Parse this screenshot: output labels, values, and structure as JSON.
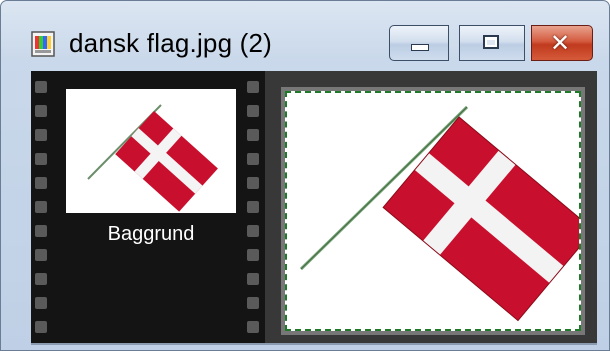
{
  "window": {
    "title": "dansk flag.jpg (2)",
    "buttons": {
      "minimize": "minimize",
      "maximize": "maximize",
      "close": "close"
    }
  },
  "filmstrip": {
    "items": [
      {
        "label": "Baggrund",
        "selected": true
      }
    ]
  },
  "icons": {
    "app": "image-file-icon",
    "minimize": "minimize-icon",
    "maximize": "maximize-icon",
    "close": "close-icon"
  },
  "colors": {
    "title_bar": "#c9d8ea",
    "close_button": "#c03a1e",
    "filmstrip": "#141414",
    "flag_red": "#c8102e",
    "selection_border": "#1f7a2a"
  }
}
